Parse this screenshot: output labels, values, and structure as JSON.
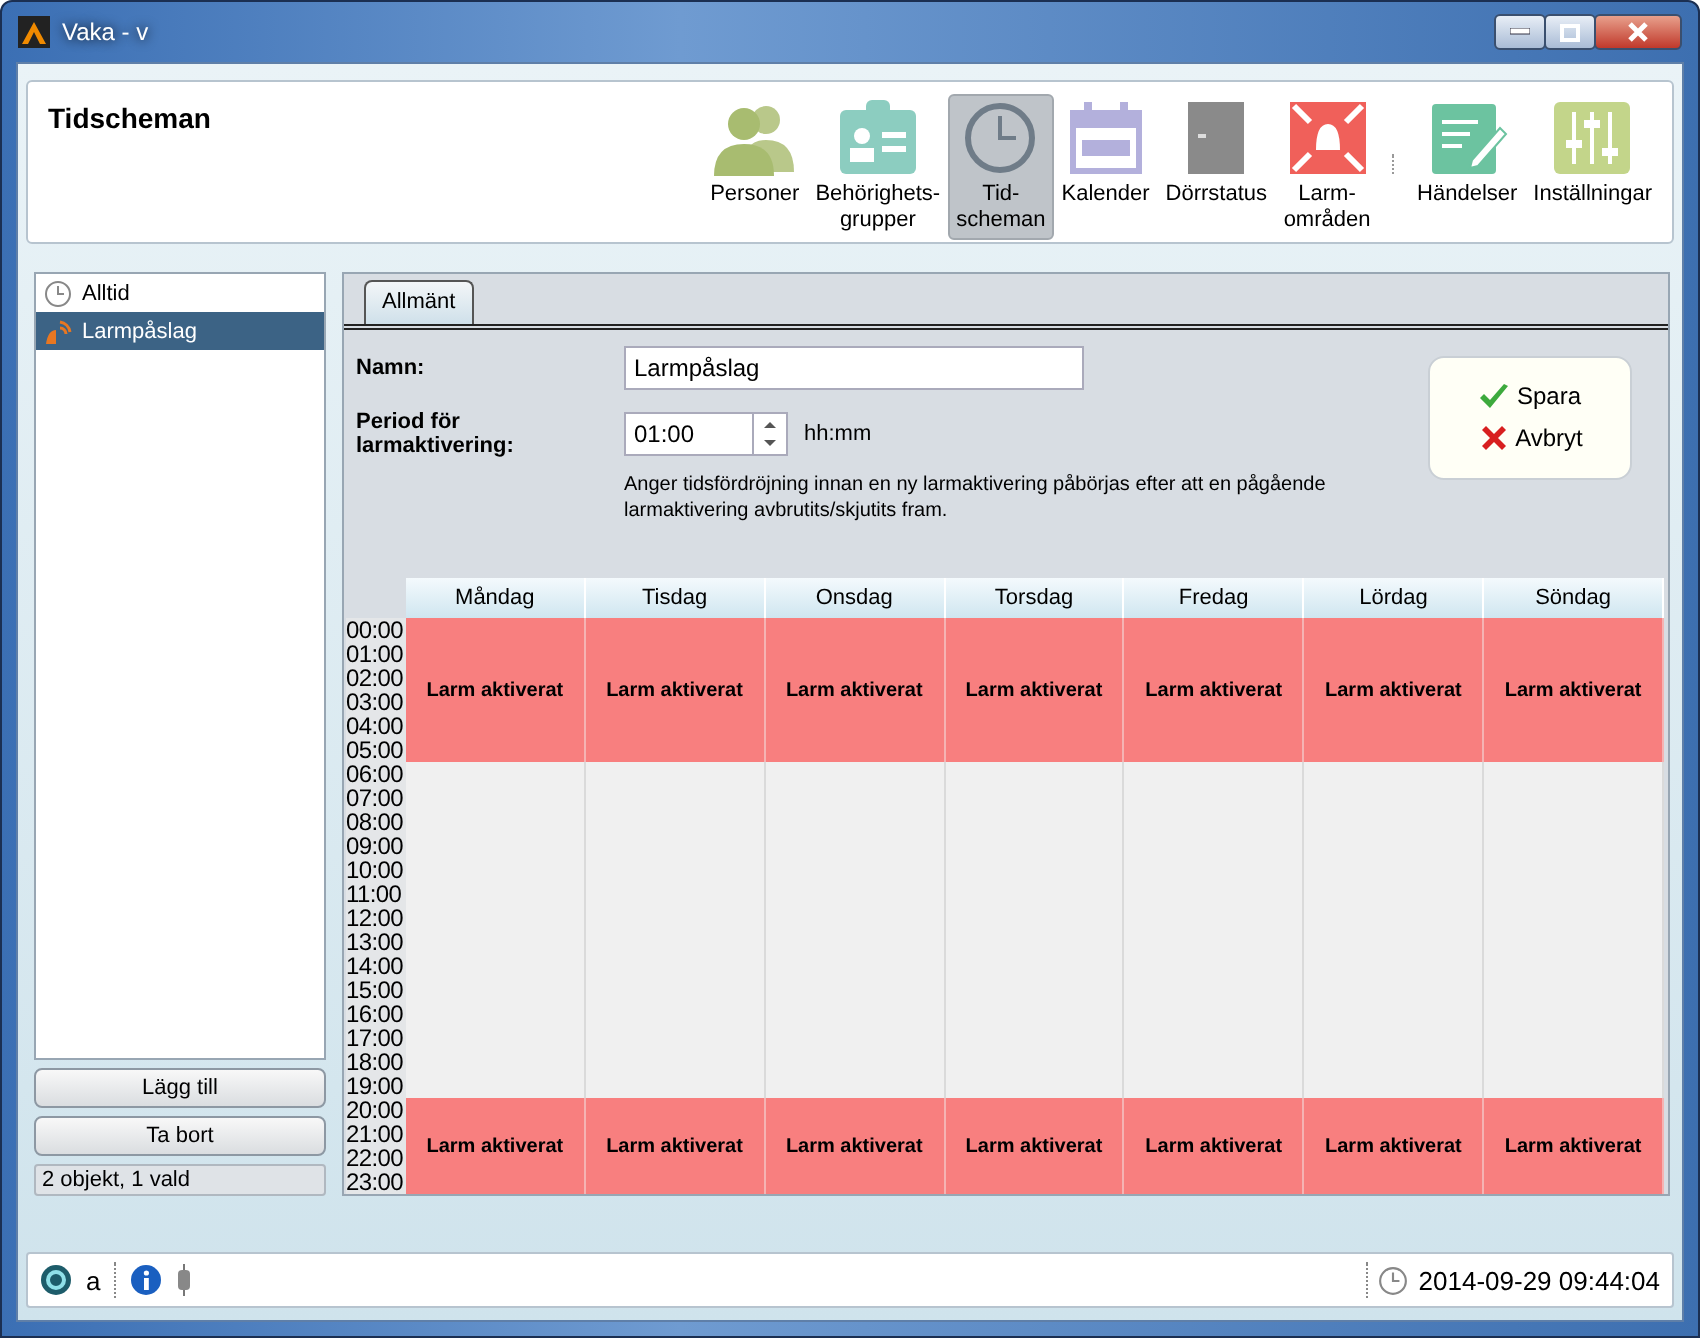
{
  "window": {
    "title": "Vaka - v"
  },
  "header": {
    "title": "Tidscheman"
  },
  "toolbar": {
    "groups": [
      {
        "items": [
          {
            "kind": "persons",
            "label": "Personer",
            "selected": false
          },
          {
            "kind": "badge",
            "label": "Behörighets-\ngrupper",
            "selected": false
          },
          {
            "kind": "clock",
            "label": "Tid-\nscheman",
            "selected": true
          },
          {
            "kind": "calendar",
            "label": "Kalender",
            "selected": false
          },
          {
            "kind": "door",
            "label": "Dörrstatus",
            "selected": false
          },
          {
            "kind": "alarm",
            "label": "Larm-\nområden",
            "selected": false
          }
        ]
      },
      {
        "items": [
          {
            "kind": "note",
            "label": "Händelser",
            "selected": false
          },
          {
            "kind": "sliders",
            "label": "Inställningar",
            "selected": false
          }
        ]
      }
    ]
  },
  "list": {
    "items": [
      {
        "kind": "clock",
        "label": "Alltid",
        "selected": false
      },
      {
        "kind": "alarm",
        "label": "Larmpåslag",
        "selected": true
      }
    ],
    "buttons": [
      "Lägg till",
      "Ta bort"
    ],
    "status": "2 objekt, 1 vald"
  },
  "tabs": [
    {
      "label": "Allmänt",
      "selected": true
    }
  ],
  "form": {
    "name_label": "Namn:",
    "name_value": "Larmpåslag",
    "period_label": "Period för larmaktivering:",
    "period_value": "01:00",
    "period_unit": "hh:mm",
    "hint": "Anger tidsfördröjning innan en ny larmaktivering påbörjas efter att en pågående larmaktivering avbrutits/skjutits fram.",
    "actions": [
      {
        "kind": "save",
        "label": "Spara"
      },
      {
        "kind": "cancel",
        "label": "Avbryt"
      }
    ]
  },
  "schedule": {
    "hours": [
      "00:00",
      "01:00",
      "02:00",
      "03:00",
      "04:00",
      "05:00",
      "06:00",
      "07:00",
      "08:00",
      "09:00",
      "10:00",
      "11:00",
      "12:00",
      "13:00",
      "14:00",
      "15:00",
      "16:00",
      "17:00",
      "18:00",
      "19:00",
      "20:00",
      "21:00",
      "22:00",
      "23:00"
    ],
    "days": [
      {
        "name": "Måndag",
        "blocks": [
          "Larm aktiverat",
          "Larm aktiverat"
        ],
        "slots": [
          {
            "on": true
          },
          {
            "on": true
          },
          {
            "on": true
          },
          {
            "on": true
          },
          {
            "on": true
          },
          {
            "on": true
          },
          {
            "on": false
          },
          {
            "on": false
          },
          {
            "on": false
          },
          {
            "on": false
          },
          {
            "on": false
          },
          {
            "on": false
          },
          {
            "on": false
          },
          {
            "on": false
          },
          {
            "on": false
          },
          {
            "on": false
          },
          {
            "on": false
          },
          {
            "on": false
          },
          {
            "on": false
          },
          {
            "on": false
          },
          {
            "on": true
          },
          {
            "on": true
          },
          {
            "on": true
          },
          {
            "on": true
          }
        ]
      },
      {
        "name": "Tisdag",
        "blocks": [
          "Larm aktiverat",
          "Larm aktiverat"
        ],
        "slots": [
          {
            "on": true
          },
          {
            "on": true
          },
          {
            "on": true
          },
          {
            "on": true
          },
          {
            "on": true
          },
          {
            "on": true
          },
          {
            "on": false
          },
          {
            "on": false
          },
          {
            "on": false
          },
          {
            "on": false
          },
          {
            "on": false
          },
          {
            "on": false
          },
          {
            "on": false
          },
          {
            "on": false
          },
          {
            "on": false
          },
          {
            "on": false
          },
          {
            "on": false
          },
          {
            "on": false
          },
          {
            "on": false
          },
          {
            "on": false
          },
          {
            "on": true
          },
          {
            "on": true
          },
          {
            "on": true
          },
          {
            "on": true
          }
        ]
      },
      {
        "name": "Onsdag",
        "blocks": [
          "Larm aktiverat",
          "Larm aktiverat"
        ],
        "slots": [
          {
            "on": true
          },
          {
            "on": true
          },
          {
            "on": true
          },
          {
            "on": true
          },
          {
            "on": true
          },
          {
            "on": true
          },
          {
            "on": false
          },
          {
            "on": false
          },
          {
            "on": false
          },
          {
            "on": false
          },
          {
            "on": false
          },
          {
            "on": false
          },
          {
            "on": false
          },
          {
            "on": false
          },
          {
            "on": false
          },
          {
            "on": false
          },
          {
            "on": false
          },
          {
            "on": false
          },
          {
            "on": false
          },
          {
            "on": false
          },
          {
            "on": true
          },
          {
            "on": true
          },
          {
            "on": true
          },
          {
            "on": true
          }
        ]
      },
      {
        "name": "Torsdag",
        "blocks": [
          "Larm aktiverat",
          "Larm aktiverat"
        ],
        "slots": [
          {
            "on": true
          },
          {
            "on": true
          },
          {
            "on": true
          },
          {
            "on": true
          },
          {
            "on": true
          },
          {
            "on": true
          },
          {
            "on": false
          },
          {
            "on": false
          },
          {
            "on": false
          },
          {
            "on": false
          },
          {
            "on": false
          },
          {
            "on": false
          },
          {
            "on": false
          },
          {
            "on": false
          },
          {
            "on": false
          },
          {
            "on": false
          },
          {
            "on": false
          },
          {
            "on": false
          },
          {
            "on": false
          },
          {
            "on": false
          },
          {
            "on": true
          },
          {
            "on": true
          },
          {
            "on": true
          },
          {
            "on": true
          }
        ]
      },
      {
        "name": "Fredag",
        "blocks": [
          "Larm aktiverat",
          "Larm aktiverat"
        ],
        "slots": [
          {
            "on": true
          },
          {
            "on": true
          },
          {
            "on": true
          },
          {
            "on": true
          },
          {
            "on": true
          },
          {
            "on": true
          },
          {
            "on": false
          },
          {
            "on": false
          },
          {
            "on": false
          },
          {
            "on": false
          },
          {
            "on": false
          },
          {
            "on": false
          },
          {
            "on": false
          },
          {
            "on": false
          },
          {
            "on": false
          },
          {
            "on": false
          },
          {
            "on": false
          },
          {
            "on": false
          },
          {
            "on": false
          },
          {
            "on": false
          },
          {
            "on": true
          },
          {
            "on": true
          },
          {
            "on": true
          },
          {
            "on": true
          }
        ]
      },
      {
        "name": "Lördag",
        "blocks": [
          "Larm aktiverat",
          "Larm aktiverat"
        ],
        "slots": [
          {
            "on": true
          },
          {
            "on": true
          },
          {
            "on": true
          },
          {
            "on": true
          },
          {
            "on": true
          },
          {
            "on": true
          },
          {
            "on": false
          },
          {
            "on": false
          },
          {
            "on": false
          },
          {
            "on": false
          },
          {
            "on": false
          },
          {
            "on": false
          },
          {
            "on": false
          },
          {
            "on": false
          },
          {
            "on": false
          },
          {
            "on": false
          },
          {
            "on": false
          },
          {
            "on": false
          },
          {
            "on": false
          },
          {
            "on": false
          },
          {
            "on": true
          },
          {
            "on": true
          },
          {
            "on": true
          },
          {
            "on": true
          }
        ]
      },
      {
        "name": "Söndag",
        "blocks": [
          "Larm aktiverat",
          "Larm aktiverat"
        ],
        "slots": [
          {
            "on": true
          },
          {
            "on": true
          },
          {
            "on": true
          },
          {
            "on": true
          },
          {
            "on": true
          },
          {
            "on": true
          },
          {
            "on": false
          },
          {
            "on": false
          },
          {
            "on": false
          },
          {
            "on": false
          },
          {
            "on": false
          },
          {
            "on": false
          },
          {
            "on": false
          },
          {
            "on": false
          },
          {
            "on": false
          },
          {
            "on": false
          },
          {
            "on": false
          },
          {
            "on": false
          },
          {
            "on": false
          },
          {
            "on": false
          },
          {
            "on": true
          },
          {
            "on": true
          },
          {
            "on": true
          },
          {
            "on": true
          }
        ]
      }
    ]
  },
  "status_bar": {
    "user": "a",
    "time": "2014-09-29 09:44:04"
  }
}
